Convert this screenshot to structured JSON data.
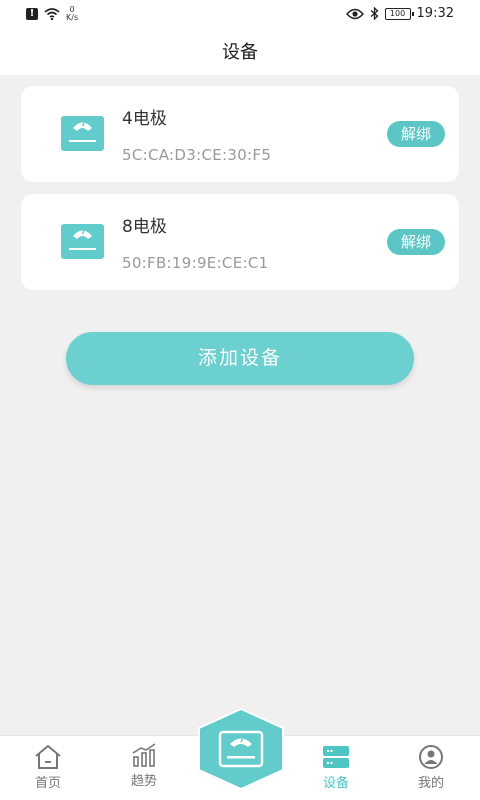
{
  "status_bar": {
    "net_speed_value": "0",
    "net_speed_unit": "K/s",
    "battery": "100",
    "time": "19:32"
  },
  "header": {
    "title": "设备"
  },
  "devices": [
    {
      "name": "4电极",
      "mac": "5C:CA:D3:CE:30:F5",
      "action_label": "解绑"
    },
    {
      "name": "8电极",
      "mac": "50:FB:19:9E:CE:C1",
      "action_label": "解绑"
    }
  ],
  "add_device_label": "添加设备",
  "bottom_nav": {
    "items": [
      {
        "label": "首页",
        "icon": "home-icon"
      },
      {
        "label": "趋势",
        "icon": "trend-icon"
      },
      {
        "label": "",
        "icon": "scale-icon"
      },
      {
        "label": "设备",
        "icon": "device-icon",
        "active": true
      },
      {
        "label": "我的",
        "icon": "profile-icon"
      }
    ]
  },
  "colors": {
    "accent": "#62cbcb",
    "background": "#f0f0f0",
    "card": "#ffffff"
  }
}
